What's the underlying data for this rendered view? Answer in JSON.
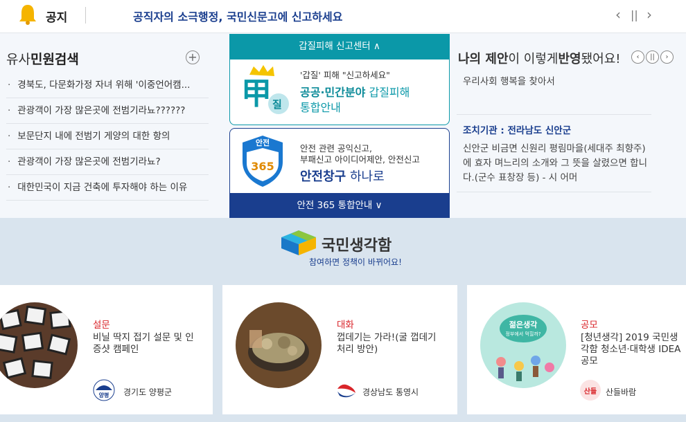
{
  "notice": {
    "title": "공지",
    "headline": "공직자의 소극행정, 국민신문고에 신고하세요",
    "prev": "‹",
    "pause": "||",
    "next": "›"
  },
  "left": {
    "title_normal": "유사",
    "title_bold": "민원검색",
    "add": "+",
    "items": [
      "경북도, 다문화가정 자녀 위해 '이중언어캠...",
      "관광객이 가장 많은곳에 전범기라뇨??????",
      "보문단지 내에 전범기 게양의 대한 항의",
      "관광객이 가장 많은곳에 전범기라뇨?",
      "대한민국이 지금 건축에 투자해야 하는 이유"
    ]
  },
  "middle": {
    "top_tab": "갑질피해 신고센터",
    "card1_line1": "'갑질' 피해 \"신고하세요\"",
    "card1_line2_bold": "공공·민간분야",
    "card1_line2_rest": " 갑질피해",
    "card1_line3": "통합안내",
    "card1_icon_char": "甲",
    "card1_badge_char": "질",
    "card2_line1": "안전 관련 공익신고,",
    "card2_line2": "부패신고 아이디어제안, 안전신고",
    "card2_line3_bold": "안전창구",
    "card2_line3_rest": " 하나로",
    "shield_top": "안전",
    "shield_num": "365",
    "bottom_tab": "안전 365 통합안내"
  },
  "right": {
    "title_a": "나의 제안",
    "title_b": "이 이렇게",
    "title_c": "반영",
    "title_d": "됐어요!",
    "prev": "‹",
    "pause": "||",
    "next": "›",
    "subtitle": "우리사회 행복을 찾아서",
    "agency": "조치기관 : 전라남도 신안군",
    "body": "신안군 비금면 신원리 평림마을(세대주 최향주)에 효자 며느리의 소개와 그 뜻을 살렸으면 합니다.(군수 표창장 등) - 시 어머"
  },
  "brand": {
    "name": "국민생각함",
    "tagline": "참여하면 정책이 바뀌어요!"
  },
  "cards": [
    {
      "category": "설문",
      "desc": "비닐 딱지 접기 설문 및 인증샷 캠페인",
      "org": "경기도 양평군",
      "org_logo_text": "양평"
    },
    {
      "category": "대화",
      "desc": "껍데기는 가라!(굴 껍데기 처리 방안)",
      "org": "경상남도 통영시"
    },
    {
      "category": "공모",
      "desc": "[청년생각] 2019 국민생각함 청소년·대학생 IDEA 공모",
      "org": "산들바람",
      "org_logo_text": "산들",
      "poster_line1": "젊은생각",
      "poster_line2": "정부에서 먹힐까?"
    }
  ],
  "colors": {
    "teal": "#0b98a8",
    "navy": "#1a3e8e",
    "red": "#d9252a"
  }
}
